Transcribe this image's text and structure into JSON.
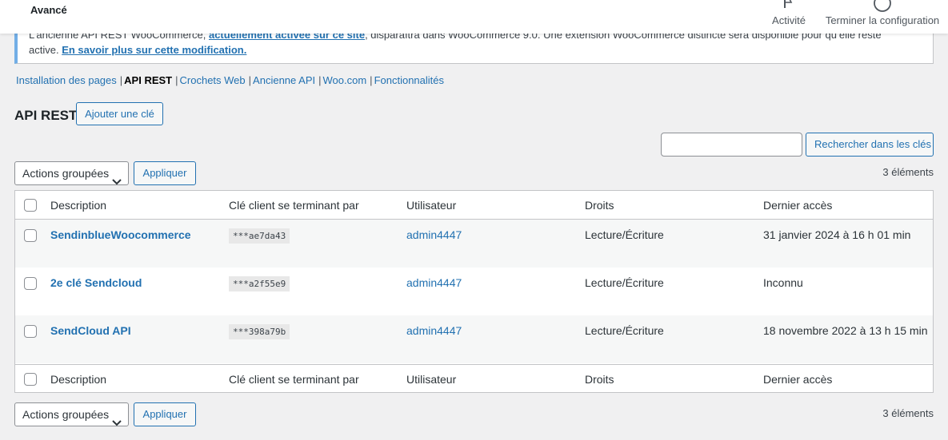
{
  "header": {
    "title": "Avancé",
    "activity_label": "Activité",
    "setup_label": "Terminer la configuration"
  },
  "notice": {
    "text_start": "L’ancienne API REST WooCommerce, ",
    "link1": "actuellement activée sur ce site",
    "text_mid": ", disparaîtra dans WooCommerce 9.0. Une extension WooCommerce distincte sera disponible pour qu’elle reste active. ",
    "link2": "En savoir plus sur cette modification."
  },
  "subnav": [
    {
      "label": "Installation des pages",
      "current": false
    },
    {
      "label": "API REST",
      "current": true
    },
    {
      "label": "Crochets Web",
      "current": false
    },
    {
      "label": "Ancienne API",
      "current": false
    },
    {
      "label": "Woo.com",
      "current": false
    },
    {
      "label": "Fonctionnalités",
      "current": false
    }
  ],
  "page": {
    "heading": "API REST",
    "add_key_label": "Ajouter une clé"
  },
  "search": {
    "placeholder": "",
    "button_label": "Rechercher dans les clés"
  },
  "bulk": {
    "selected": "Actions groupées",
    "apply_label": "Appliquer",
    "count": "3 éléments"
  },
  "table": {
    "columns": [
      "Description",
      "Clé client se terminant par",
      "Utilisateur",
      "Droits",
      "Dernier accès"
    ],
    "rows": [
      {
        "description": "SendinblueWoocommerce",
        "key": "***ae7da43",
        "user": "admin4447",
        "rights": "Lecture/Écriture",
        "last_access": "31 janvier 2024 à 16 h 01 min"
      },
      {
        "description": "2e clé Sendcloud",
        "key": "***a2f55e9",
        "user": "admin4447",
        "rights": "Lecture/Écriture",
        "last_access": "Inconnu"
      },
      {
        "description": "SendCloud API",
        "key": "***398a79b",
        "user": "admin4447",
        "rights": "Lecture/Écriture",
        "last_access": "18 novembre 2022 à 13 h 15 min"
      }
    ]
  },
  "icons": {
    "activity": "flag-icon",
    "setup": "progress-circle-icon",
    "dropdown": "chevron-down-icon"
  },
  "colors": {
    "accent": "#2271b1",
    "notice_border": "#72aee6",
    "background": "#f0f0f1"
  }
}
